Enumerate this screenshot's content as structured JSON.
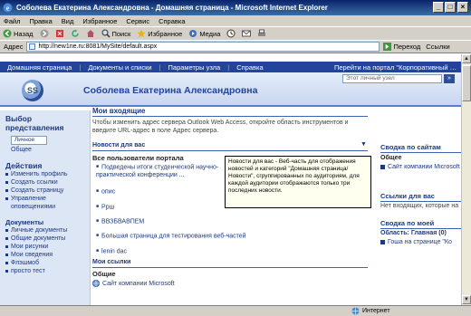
{
  "window": {
    "title": "Соболева Екатерина Александровна - Домашняя страница - Microsoft Internet Explorer",
    "controls": [
      "_",
      "□",
      "×"
    ]
  },
  "menu": [
    "Файл",
    "Правка",
    "Вид",
    "Избранное",
    "Сервис",
    "Справка"
  ],
  "toolbar": {
    "back": "Назад",
    "search": "Поиск",
    "favorites": "Избранное",
    "media": "Медиа"
  },
  "address": {
    "label": "Адрес",
    "url": "http://new1ne.ru:8081/MySite/default.aspx",
    "go": "Переход",
    "links": "Ссылки"
  },
  "portal_nav": {
    "items": [
      "Домашняя страница",
      "Документы и списки",
      "Параметры узла",
      "Справка"
    ],
    "right": "Перейти на портал \"Корпоративный портал\""
  },
  "header": {
    "user_name": "Соболева Екатерина Александровна",
    "logo": "SS",
    "search_placeholder": "Этот личный узел",
    "search_go": "»"
  },
  "leftnav": {
    "select_heading": "Выбор представления",
    "views": [
      "Личное",
      "Общее"
    ],
    "actions_heading": "Действия",
    "actions": [
      "Изменить профиль",
      "Создать ссылки",
      "Создать страницу",
      "Управление оповещениями"
    ],
    "docs_heading": "Документы",
    "docs": [
      "Личные документы",
      "Общие документы",
      "Мои рисунки",
      "Мои сведения",
      "Флэшмоб"
    ],
    "more": "просто тест"
  },
  "center": {
    "inbox_title": "Мои входящие",
    "inbox_text": "Чтобы изменить адрес сервера Outlook Web Access, откройте область инструментов и введите URL-адрес в поле Адрес сервера.",
    "news_title": "Новости для вас",
    "all_users_title": "Все пользователи портала",
    "news_items": [
      "Подведены итоги студенческой научно-практической конференции ...",
      "опис",
      "Ррш",
      "ВВЗБВАВПЕМ",
      "Большая страница для тестирования веб-частей",
      "lenin dac"
    ],
    "tooltip": "Новости для вас - Веб-часть для отображения новостей и категорий \"Домашняя страница/Новости\", сгруппированных по аудиториям, для каждой аудитории отображаются только три последних новости.",
    "links_title": "Мои ссылки",
    "links_sub": "Общие",
    "links_items": [
      "Сайт компании Microsoft"
    ]
  },
  "right": {
    "sites_title": "Сводка по сайтам",
    "sites_sub": "Общее",
    "sites_link": "Сайт компании Microsoft",
    "links_title": "Ссылки для вас",
    "links_text": "Нет входящих, которые на",
    "work_title": "Сводка по моей",
    "work_sub": "Область: Главная (0)",
    "work_link": "Гоша на странице \"Ко"
  },
  "status": {
    "left": "",
    "zone": "Интернет"
  }
}
